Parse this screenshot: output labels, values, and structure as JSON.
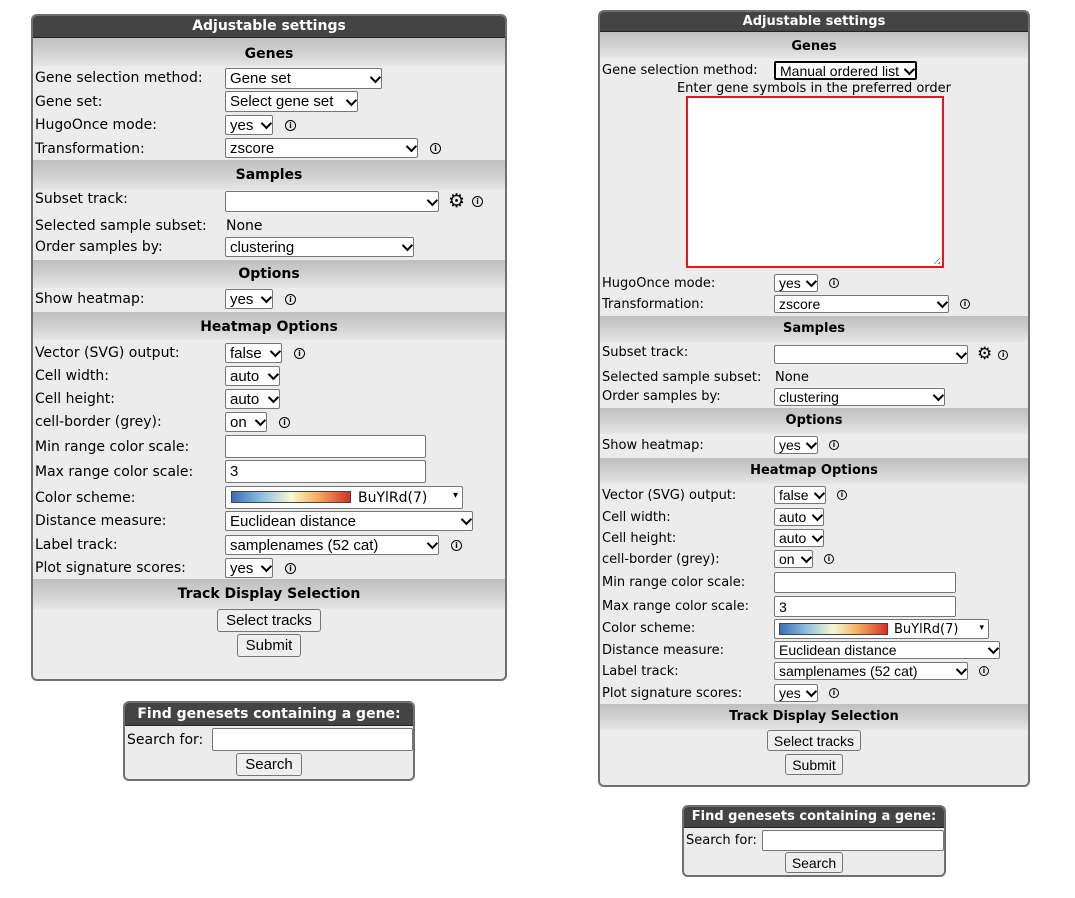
{
  "panel_title": "Adjustable settings",
  "sections": {
    "genes": "Genes",
    "samples": "Samples",
    "options": "Options",
    "heatmap": "Heatmap Options",
    "tracks": "Track Display Selection"
  },
  "labels": {
    "gene_method": "Gene selection method:",
    "gene_set": "Gene set:",
    "hugoonce": "HugoOnce mode:",
    "transformation": "Transformation:",
    "subset_track": "Subset track:",
    "selected_subset": "Selected sample subset:",
    "order_samples": "Order samples by:",
    "show_heatmap": "Show heatmap:",
    "vector_svg": "Vector (SVG) output:",
    "cell_width": "Cell width:",
    "cell_height": "Cell height:",
    "cell_border": "cell-border (grey):",
    "min_range": "Min range color scale:",
    "max_range": "Max range color scale:",
    "color_scheme": "Color scheme:",
    "distance": "Distance measure:",
    "label_track": "Label track:",
    "plot_sig": "Plot signature scores:"
  },
  "values": {
    "hugoonce": "yes",
    "transformation": "zscore",
    "subset_track": "",
    "selected_subset": "None",
    "order_samples": "clustering",
    "show_heatmap": "yes",
    "vector_svg": "false",
    "cell_width": "auto",
    "cell_height": "auto",
    "cell_border": "on",
    "min_range": "",
    "max_range": "3",
    "color_scheme": "BuYlRd(7)",
    "distance": "Euclidean distance",
    "label_track": "samplenames (52 cat)",
    "plot_sig": "yes"
  },
  "left": {
    "gene_method": "Gene set",
    "gene_set": "Select gene set"
  },
  "right": {
    "gene_method": "Manual ordered list",
    "textarea_prompt": "Enter gene symbols in the preferred order",
    "textarea_value": ""
  },
  "buttons": {
    "select_tracks": "Select tracks",
    "submit": "Submit",
    "search": "Search"
  },
  "find": {
    "title": "Find genesets containing a gene:",
    "label": "Search for:",
    "value": ""
  },
  "icons": {
    "info": "info-icon",
    "gear": "gear-icon"
  },
  "glyphs": {
    "info": "i",
    "gear": "⚙"
  },
  "colors": {
    "textarea_border": "#e8161b",
    "title_bar": "#444444"
  }
}
